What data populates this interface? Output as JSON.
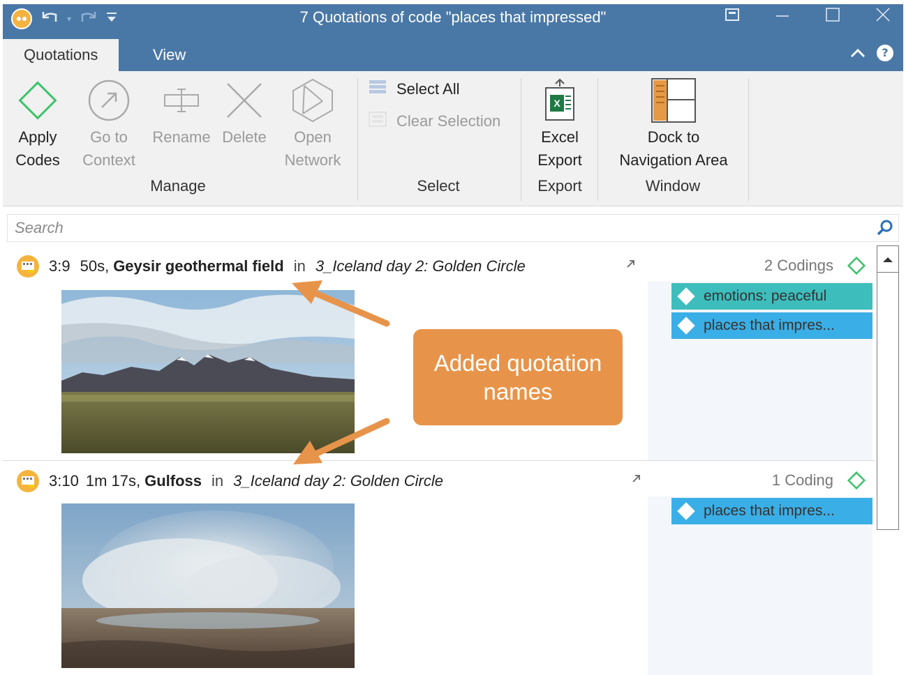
{
  "window": {
    "title": "7 Quotations of code \"places that impressed\""
  },
  "tabs": [
    {
      "label": "Quotations"
    },
    {
      "label": "View"
    }
  ],
  "ribbon": {
    "apply_codes": [
      "Apply",
      "Codes"
    ],
    "go_to_context": [
      "Go to",
      "Context"
    ],
    "rename": "Rename",
    "delete": "Delete",
    "open_network": [
      "Open",
      "Network"
    ],
    "manage_group": "Manage",
    "select_all": "Select All",
    "clear_selection": "Clear Selection",
    "select_group": "Select",
    "excel_export": [
      "Excel",
      "Export"
    ],
    "export_group": "Export",
    "dock_nav": [
      "Dock to",
      "Navigation Area"
    ],
    "window_group": "Window"
  },
  "search": {
    "placeholder": "Search"
  },
  "quotations": [
    {
      "id": "3:9",
      "time": "50s,",
      "name": "Geysir geothermal field",
      "in": "in",
      "document": "3_Iceland day 2: Golden Circle",
      "codings_count": "2 Codings",
      "codes": [
        "emotions: peaceful",
        "places that impres..."
      ]
    },
    {
      "id": "3:10",
      "time": "1m 17s,",
      "name": "Gulfoss",
      "in": "in",
      "document": "3_Iceland day 2: Golden Circle",
      "codings_count": "1 Coding",
      "codes": [
        "places that impres..."
      ]
    }
  ],
  "callout": {
    "text": "Added quotation names"
  },
  "colors": {
    "titlebar": "#4a78a6",
    "ribbon": "#f1f1f1",
    "code_teal": "#3ebdbd",
    "code_blue": "#3aaee6",
    "callout": "#e7944a",
    "code_green": "#3cc36a"
  },
  "icons": [
    "app-icon",
    "undo-icon",
    "redo-icon",
    "customize-icon",
    "minimize-ribbon-icon",
    "minimize-icon",
    "maximize-icon",
    "close-icon",
    "chevron-up-icon",
    "help-icon",
    "apply-codes-icon",
    "go-to-context-icon",
    "rename-icon",
    "delete-icon",
    "open-network-icon",
    "select-all-icon",
    "clear-selection-icon",
    "excel-icon",
    "dock-icon",
    "search-icon",
    "video-quotation-icon",
    "open-link-icon",
    "code-diamond-icon"
  ]
}
